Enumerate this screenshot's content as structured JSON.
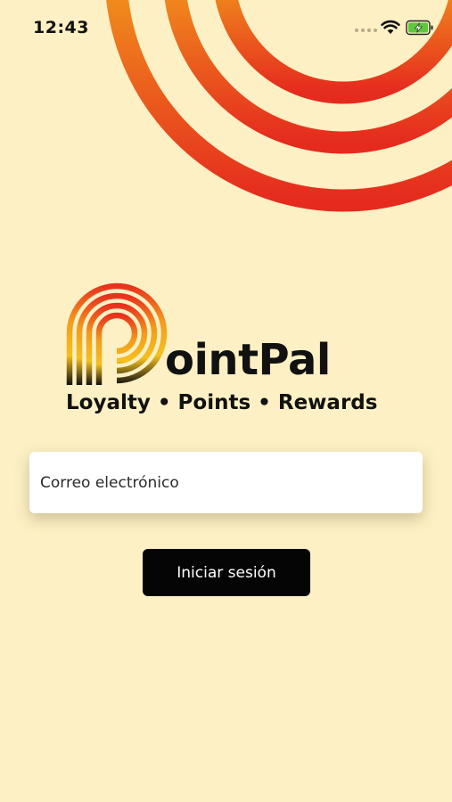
{
  "status_bar": {
    "time": "12:43",
    "icons": [
      "signal-dots-icon",
      "wifi-icon",
      "battery-charging-icon"
    ]
  },
  "decoration": {
    "icon": "concentric-rings-graphic",
    "gradient_colors": [
      "#f7c51e",
      "#f39a1c",
      "#e8311e"
    ]
  },
  "logo": {
    "wordmark": "ointPal",
    "tagline": "Loyalty • Points • Rewards",
    "icon": "pointpal-p-logo"
  },
  "login_form": {
    "email_placeholder": "Correo electrónico",
    "email_value": "",
    "submit_label": "Iniciar sesión"
  },
  "colors": {
    "background": "#fcf0c4",
    "button": "#050505",
    "button_text": "#ffffff",
    "battery": "#5cc83a"
  }
}
